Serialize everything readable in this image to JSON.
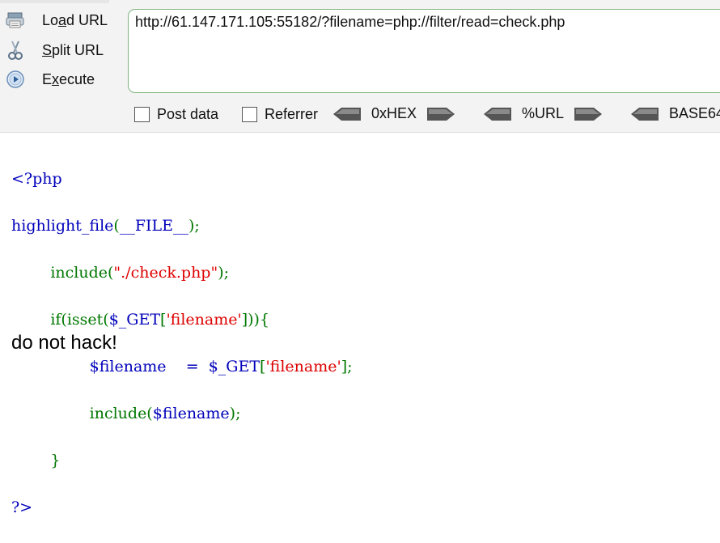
{
  "toolbar": {
    "load_url": {
      "pre": "Lo",
      "acc": "a",
      "post": "d URL",
      "icon": "load-url-icon"
    },
    "split_url": {
      "pre": "",
      "acc": "S",
      "post": "plit URL",
      "icon": "split-url-icon"
    },
    "execute": {
      "pre": "E",
      "acc": "x",
      "post": "ecute",
      "icon": "execute-icon"
    },
    "url_value": "http://61.147.171.105:55182/?filename=php://filter/read=check.php",
    "post_data_label": "Post data",
    "referrer_label": "Referrer",
    "post_data_checked": false,
    "referrer_checked": false,
    "encoders": [
      "0xHEX",
      "%URL",
      "BASE64"
    ]
  },
  "source": {
    "open_tag": "<?php",
    "l2_a": "highlight_file",
    "l2_b": "(",
    "l2_c": "__FILE__",
    "l2_d": ");",
    "l3_a": "        include(",
    "l3_b": "\"./check.php\"",
    "l3_c": ");",
    "l4_a": "        if(isset(",
    "l4_b": "$_GET",
    "l4_c": "[",
    "l4_d": "'filename'",
    "l4_e": "])){",
    "l5_a": "                $filename    =  $_GET",
    "l5_b": "[",
    "l5_c": "'filename'",
    "l5_d": "];",
    "l6_a": "                include(",
    "l6_b": "$filename",
    "l6_c": ");",
    "l7": "        }",
    "close_tag": "?>"
  },
  "output_text": "do not hack!",
  "colors": {
    "keyword": "#0000bb",
    "function": "#007700",
    "string": "#dd0000",
    "url_border": "#7fb37f"
  }
}
